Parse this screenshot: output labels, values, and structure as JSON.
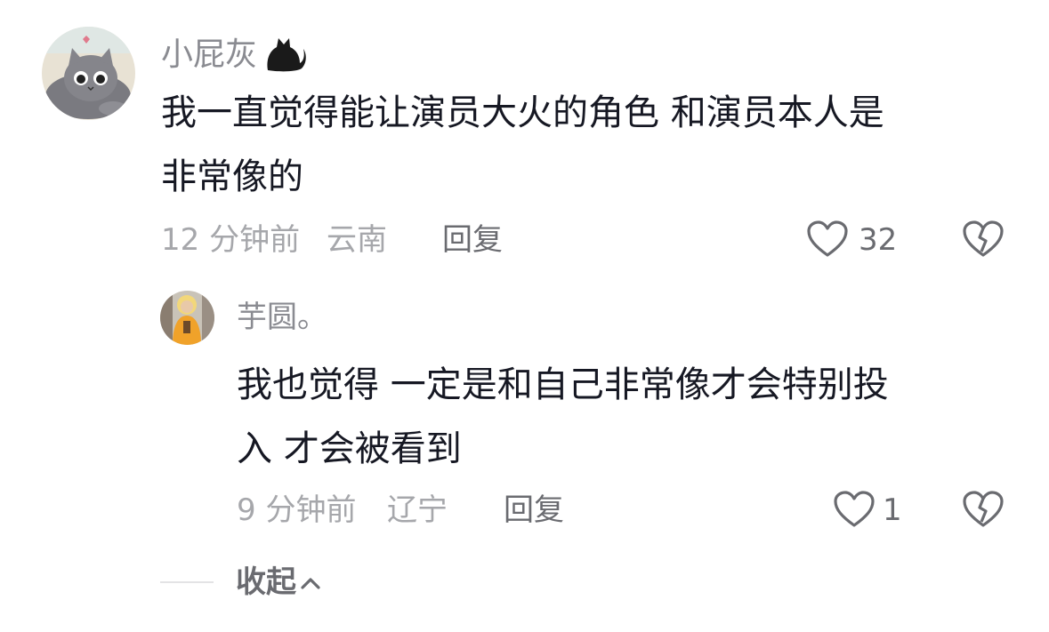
{
  "comments": [
    {
      "username": "小屁灰",
      "text_lines": [
        "我一直觉得能让演员大火的角色 和演员本人是",
        "非常像的"
      ],
      "time": "12 分钟前",
      "location": "云南",
      "reply_label": "回复",
      "likes": "32",
      "avatar_icon": "cat-avatar",
      "username_icon": "black-cat-icon",
      "replies": [
        {
          "username": "芋圆。",
          "text_lines": [
            "我也觉得 一定是和自己非常像才会特别投",
            "入 才会被看到"
          ],
          "time": "9 分钟前",
          "location": "辽宁",
          "reply_label": "回复",
          "likes": "1",
          "avatar_icon": "monk-avatar"
        }
      ]
    }
  ],
  "collapse_label": "收起",
  "colors": {
    "text_primary": "#161823",
    "text_secondary": "#8a8b91",
    "meta": "#a6a7ab",
    "action": "#6a6b70"
  }
}
